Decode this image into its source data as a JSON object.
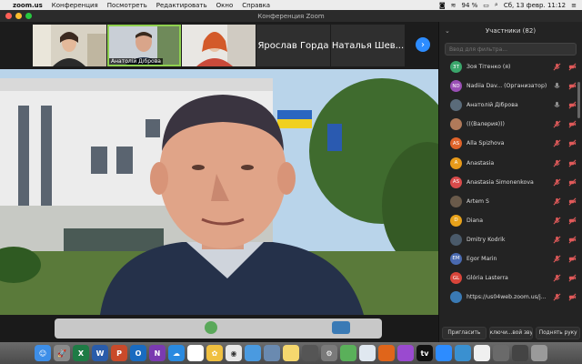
{
  "menubar": {
    "app_name": "zoom.us",
    "items": [
      "Конференция",
      "Посмотреть",
      "Редактировать",
      "Окно",
      "Справка"
    ],
    "battery": "94 %",
    "datetime": "Сб, 13 февр. 11:12"
  },
  "window": {
    "title": "Конференция Zoom"
  },
  "gallery": {
    "tiles": [
      {
        "type": "video",
        "label": ""
      },
      {
        "type": "video",
        "label": "Анатолій Діброва"
      },
      {
        "type": "video",
        "label": ""
      },
      {
        "type": "name",
        "label": "Ярослав Горда"
      },
      {
        "type": "name",
        "label": "Наталья Шев..."
      }
    ],
    "next_icon": "chevron-right-icon"
  },
  "panel": {
    "title": "Участники (82)",
    "search_placeholder": "Ввод для фильтра...",
    "participants": [
      {
        "initials": "ЗТ",
        "name": "Зоя Тітенко (я)",
        "color": "#3aa66b",
        "mic": "muted"
      },
      {
        "initials": "ND",
        "name": "Nadiia Dav... (Организатор)",
        "color": "#9a4fb5",
        "mic": "active"
      },
      {
        "initials": "",
        "name": "Анатолій Діброва",
        "color": "#5a6b7a",
        "mic": "active"
      },
      {
        "initials": "",
        "name": "(((Валерия)))",
        "color": "#b07a5a",
        "mic": "muted"
      },
      {
        "initials": "AS",
        "name": "Alla Spizhova",
        "color": "#e0632a",
        "mic": "muted"
      },
      {
        "initials": "A",
        "name": "Anastasia",
        "color": "#e89a1a",
        "mic": "muted"
      },
      {
        "initials": "AS",
        "name": "Anastasia Simonenkova",
        "color": "#d94b4b",
        "mic": "muted"
      },
      {
        "initials": "",
        "name": "Artem S",
        "color": "#6a5a4a",
        "mic": "muted"
      },
      {
        "initials": "D",
        "name": "Diana",
        "color": "#e8a21a",
        "mic": "muted"
      },
      {
        "initials": "",
        "name": "Dmitry Kodrik",
        "color": "#4a5a6a",
        "mic": "muted"
      },
      {
        "initials": "EM",
        "name": "Egor Marin",
        "color": "#4a6ab0",
        "mic": "muted"
      },
      {
        "initials": "GL",
        "name": "Glória Lasterra",
        "color": "#d9453a",
        "mic": "muted"
      },
      {
        "initials": "",
        "name": "https://us04web.zoom.us/j...",
        "color": "#3a7ab5",
        "mic": "muted"
      }
    ],
    "footer": {
      "invite": "Пригласить",
      "unmute_all": "Включи...вой звук",
      "raise_hand": "Поднять руку"
    }
  },
  "dock": {
    "apps": [
      {
        "name": "finder-icon",
        "color": "#3d8ee8",
        "glyph": "☺"
      },
      {
        "name": "launchpad-icon",
        "color": "#8a8a8a",
        "glyph": "🚀"
      },
      {
        "name": "excel-icon",
        "color": "#1e7b45",
        "glyph": "X"
      },
      {
        "name": "word-icon",
        "color": "#2a5caa",
        "glyph": "W"
      },
      {
        "name": "powerpoint-icon",
        "color": "#c94a2a",
        "glyph": "P"
      },
      {
        "name": "outlook-icon",
        "color": "#1a6bc0",
        "glyph": "O"
      },
      {
        "name": "onenote-icon",
        "color": "#7a3ab0",
        "glyph": "N"
      },
      {
        "name": "onedrive-icon",
        "color": "#2a8ae0",
        "glyph": "☁"
      },
      {
        "name": "calendar-icon",
        "color": "#ffffff",
        "glyph": ""
      },
      {
        "name": "photos-icon",
        "color": "#f0c040",
        "glyph": "✿"
      },
      {
        "name": "chrome-icon",
        "color": "#e8e8e8",
        "glyph": "◉"
      },
      {
        "name": "folder-icon",
        "color": "#4a9ae0",
        "glyph": ""
      },
      {
        "name": "preview-icon",
        "color": "#6a8ab0",
        "glyph": ""
      },
      {
        "name": "notes-icon",
        "color": "#f5d76e",
        "glyph": ""
      },
      {
        "name": "calculator-icon",
        "color": "#555555",
        "glyph": ""
      },
      {
        "name": "settings-icon",
        "color": "#7a7a7a",
        "glyph": "⚙"
      },
      {
        "name": "maps-icon",
        "color": "#5ab05a",
        "glyph": ""
      },
      {
        "name": "safari-icon",
        "color": "#e0e8f0",
        "glyph": ""
      },
      {
        "name": "firefox-icon",
        "color": "#e0651a",
        "glyph": ""
      },
      {
        "name": "podcasts-icon",
        "color": "#9a4ad0",
        "glyph": ""
      },
      {
        "name": "appletv-icon",
        "color": "#111111",
        "glyph": "tv"
      },
      {
        "name": "zoom-icon",
        "color": "#2d8cff",
        "glyph": ""
      },
      {
        "name": "safari-compass-icon",
        "color": "#3a90d0",
        "glyph": ""
      },
      {
        "name": "textedit-icon",
        "color": "#f0f0f0",
        "glyph": ""
      },
      {
        "name": "downloads-icon",
        "color": "#6a6a6a",
        "glyph": ""
      },
      {
        "name": "screenshot-icon",
        "color": "#444444",
        "glyph": ""
      },
      {
        "name": "trash-icon",
        "color": "#9a9a9a",
        "glyph": ""
      }
    ]
  }
}
